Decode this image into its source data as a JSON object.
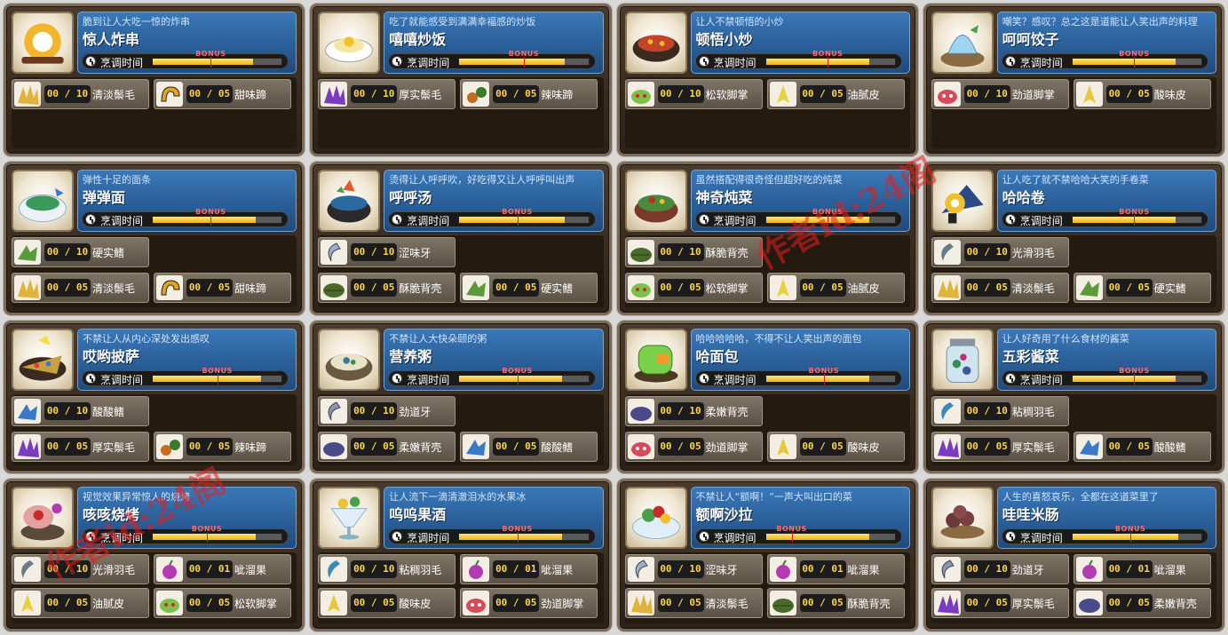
{
  "cook_time_label": "烹调时间",
  "bonus_label": "BONUS",
  "watermark_text": "作者id:24阁",
  "recipes": [
    {
      "name": "惊人炸串",
      "desc": "脆到让人大吃一惊的炸串",
      "icon": "fried-skewer-icon",
      "progress": 0.78,
      "bonus": 0.45,
      "layout": "row2",
      "ingredients": [
        {
          "count": "00 / 10",
          "name": "清淡鬃毛",
          "icon": "mane-icon"
        },
        {
          "count": "00 / 05",
          "name": "甜味蹄",
          "icon": "hoof-icon"
        }
      ]
    },
    {
      "name": "嘻嘻炒饭",
      "desc": "吃了就能感受到满满幸福感的炒饭",
      "icon": "fried-rice-icon",
      "progress": 0.82,
      "bonus": 0.5,
      "layout": "row2",
      "ingredients": [
        {
          "count": "00 / 10",
          "name": "厚实鬃毛",
          "icon": "thick-mane-icon"
        },
        {
          "count": "00 / 05",
          "name": "辣味蹄",
          "icon": "spicy-hoof-icon"
        }
      ]
    },
    {
      "name": "顿悟小炒",
      "desc": "让人不禁顿悟的小炒",
      "icon": "stir-fry-icon",
      "progress": 0.8,
      "bonus": 0.48,
      "layout": "row2",
      "ingredients": [
        {
          "count": "00 / 10",
          "name": "松软脚掌",
          "icon": "soft-paw-icon"
        },
        {
          "count": "00 / 05",
          "name": "油腻皮",
          "icon": "oily-skin-icon"
        }
      ]
    },
    {
      "name": "呵呵饺子",
      "desc": "嘲笑？感叹？总之这是道能让人笑出声的料理",
      "icon": "dumpling-icon",
      "progress": 0.8,
      "bonus": 0.48,
      "layout": "row2",
      "ingredients": [
        {
          "count": "00 / 10",
          "name": "劲道脚掌",
          "icon": "chewy-paw-icon"
        },
        {
          "count": "00 / 05",
          "name": "酸味皮",
          "icon": "sour-skin-icon"
        }
      ]
    },
    {
      "name": "弹弹面",
      "desc": "弹性十足的面条",
      "icon": "noodle-icon",
      "progress": 0.8,
      "bonus": 0.45,
      "layout": "row12",
      "ingredients": [
        {
          "count": "00 / 10",
          "name": "硬实鳍",
          "icon": "hard-fin-icon"
        },
        {
          "count": "00 / 05",
          "name": "清淡鬃毛",
          "icon": "mane-icon"
        },
        {
          "count": "00 / 05",
          "name": "甜味蹄",
          "icon": "hoof-icon"
        }
      ]
    },
    {
      "name": "呼呼汤",
      "desc": "烫得让人呼呼吹，好吃得又让人呼呼叫出声",
      "icon": "hot-soup-icon",
      "progress": 0.82,
      "bonus": 0.45,
      "layout": "row12",
      "ingredients": [
        {
          "count": "00 / 10",
          "name": "涩味牙",
          "icon": "astringent-tooth-icon"
        },
        {
          "count": "00 / 05",
          "name": "酥脆背壳",
          "icon": "crispy-shell-icon"
        },
        {
          "count": "00 / 05",
          "name": "硬实鳍",
          "icon": "hard-fin-icon"
        }
      ]
    },
    {
      "name": "神奇炖菜",
      "desc": "虽然搭配得很奇怪但超好吃的炖菜",
      "icon": "stew-icon",
      "progress": 0.8,
      "bonus": 0.48,
      "layout": "row12",
      "ingredients": [
        {
          "count": "00 / 10",
          "name": "酥脆背壳",
          "icon": "crispy-shell-icon"
        },
        {
          "count": "00 / 05",
          "name": "松软脚掌",
          "icon": "soft-paw-icon"
        },
        {
          "count": "00 / 05",
          "name": "油腻皮",
          "icon": "oily-skin-icon"
        }
      ]
    },
    {
      "name": "哈哈卷",
      "desc": "让人吃了就不禁哈哈大笑的手卷菜",
      "icon": "hand-roll-icon",
      "progress": 0.8,
      "bonus": 0.48,
      "layout": "row12",
      "ingredients": [
        {
          "count": "00 / 10",
          "name": "光滑羽毛",
          "icon": "smooth-feather-icon"
        },
        {
          "count": "00 / 05",
          "name": "清淡鬃毛",
          "icon": "mane-icon"
        },
        {
          "count": "00 / 05",
          "name": "硬实鳍",
          "icon": "hard-fin-icon"
        }
      ]
    },
    {
      "name": "哎哟披萨",
      "desc": "不禁让人从内心深处发出感叹",
      "icon": "pizza-icon",
      "progress": 0.84,
      "bonus": 0.5,
      "layout": "row12",
      "ingredients": [
        {
          "count": "00 / 10",
          "name": "酸酸鳍",
          "icon": "sour-fin-icon"
        },
        {
          "count": "00 / 05",
          "name": "厚实鬃毛",
          "icon": "thick-mane-icon"
        },
        {
          "count": "00 / 05",
          "name": "辣味蹄",
          "icon": "spicy-hoof-icon"
        }
      ]
    },
    {
      "name": "营养粥",
      "desc": "不禁让人大快朵颐的粥",
      "icon": "porridge-icon",
      "progress": 0.8,
      "bonus": 0.45,
      "layout": "row12",
      "ingredients": [
        {
          "count": "00 / 10",
          "name": "劲道牙",
          "icon": "chewy-tooth-icon"
        },
        {
          "count": "00 / 05",
          "name": "柔嫩背壳",
          "icon": "tender-shell-icon"
        },
        {
          "count": "00 / 05",
          "name": "酸酸鳍",
          "icon": "sour-fin-icon"
        }
      ]
    },
    {
      "name": "哈面包",
      "desc": "哈哈哈哈哈，不得不让人笑出声的面包",
      "icon": "bread-icon",
      "progress": 0.8,
      "bonus": 0.45,
      "layout": "row12",
      "ingredients": [
        {
          "count": "00 / 10",
          "name": "柔嫩背壳",
          "icon": "tender-shell-icon"
        },
        {
          "count": "00 / 05",
          "name": "劲道脚掌",
          "icon": "chewy-paw-icon"
        },
        {
          "count": "00 / 05",
          "name": "酸味皮",
          "icon": "sour-skin-icon"
        }
      ]
    },
    {
      "name": "五彩酱菜",
      "desc": "让人好奇用了什么食材的酱菜",
      "icon": "pickle-jar-icon",
      "progress": 0.8,
      "bonus": 0.48,
      "layout": "row12",
      "ingredients": [
        {
          "count": "00 / 10",
          "name": "粘稠羽毛",
          "icon": "sticky-feather-icon"
        },
        {
          "count": "00 / 05",
          "name": "厚实鬃毛",
          "icon": "thick-mane-icon"
        },
        {
          "count": "00 / 05",
          "name": "酸酸鳍",
          "icon": "sour-fin-icon"
        }
      ]
    },
    {
      "name": "咳咳烧烤",
      "desc": "视觉效果异常惊人的烧烤",
      "icon": "barbecue-icon",
      "progress": 0.8,
      "bonus": 0.42,
      "layout": "row22",
      "ingredients": [
        {
          "count": "00 / 10",
          "name": "光滑羽毛",
          "icon": "smooth-feather-icon"
        },
        {
          "count": "00 / 01",
          "name": "呲溜果",
          "icon": "slurp-fruit-icon"
        },
        {
          "count": "00 / 05",
          "name": "油腻皮",
          "icon": "oily-skin-icon"
        },
        {
          "count": "00 / 05",
          "name": "松软脚掌",
          "icon": "soft-paw-icon"
        }
      ]
    },
    {
      "name": "呜呜果酒",
      "desc": "让人流下一滴清澈泪水的水果冰",
      "icon": "fruit-drink-icon",
      "progress": 0.8,
      "bonus": 0.45,
      "layout": "row22",
      "ingredients": [
        {
          "count": "00 / 10",
          "name": "粘稠羽毛",
          "icon": "sticky-feather-icon"
        },
        {
          "count": "00 / 01",
          "name": "呲溜果",
          "icon": "slurp-fruit-icon"
        },
        {
          "count": "00 / 05",
          "name": "酸味皮",
          "icon": "sour-skin-icon"
        },
        {
          "count": "00 / 05",
          "name": "劲道脚掌",
          "icon": "chewy-paw-icon"
        }
      ]
    },
    {
      "name": "额啊沙拉",
      "desc": "不禁让人“额啊！”一声大叫出口的菜",
      "icon": "salad-icon",
      "progress": 0.8,
      "bonus": 0.2,
      "layout": "row22",
      "ingredients": [
        {
          "count": "00 / 10",
          "name": "涩味牙",
          "icon": "astringent-tooth-icon"
        },
        {
          "count": "00 / 01",
          "name": "呲溜果",
          "icon": "slurp-fruit-icon"
        },
        {
          "count": "00 / 05",
          "name": "清淡鬃毛",
          "icon": "mane-icon"
        },
        {
          "count": "00 / 05",
          "name": "酥脆背壳",
          "icon": "crispy-shell-icon"
        }
      ]
    },
    {
      "name": "哇哇米肠",
      "desc": "人生的喜怒哀乐，全都在这道菜里了",
      "icon": "sausage-icon",
      "progress": 0.82,
      "bonus": 0.45,
      "layout": "row22",
      "ingredients": [
        {
          "count": "00 / 10",
          "name": "劲道牙",
          "icon": "chewy-tooth-icon"
        },
        {
          "count": "00 / 01",
          "name": "呲溜果",
          "icon": "slurp-fruit-icon"
        },
        {
          "count": "00 / 05",
          "name": "厚实鬃毛",
          "icon": "thick-mane-icon"
        },
        {
          "count": "00 / 05",
          "name": "柔嫩背壳",
          "icon": "tender-shell-icon"
        }
      ]
    }
  ],
  "colors": {
    "mane-icon": "#e0b33a",
    "hoof-icon": "#e6a21c",
    "thick-mane-icon": "#7a3bc0",
    "spicy-hoof-icon": "#c86a1c",
    "soft-paw-icon": "#7ec04a",
    "oily-skin-icon": "#e6d23a",
    "chewy-paw-icon": "#d84a5a",
    "sour-skin-icon": "#e8c83a",
    "hard-fin-icon": "#5a9a3a",
    "astringent-tooth-icon": "#9ab0c8",
    "crispy-shell-icon": "#4a6a2a",
    "smooth-feather-icon": "#6a7a8a",
    "sour-fin-icon": "#3a78c8",
    "chewy-tooth-icon": "#8a94b4",
    "tender-shell-icon": "#4a4a8a",
    "sticky-feather-icon": "#3a8ab8",
    "slurp-fruit-icon": "#b43ab4"
  }
}
